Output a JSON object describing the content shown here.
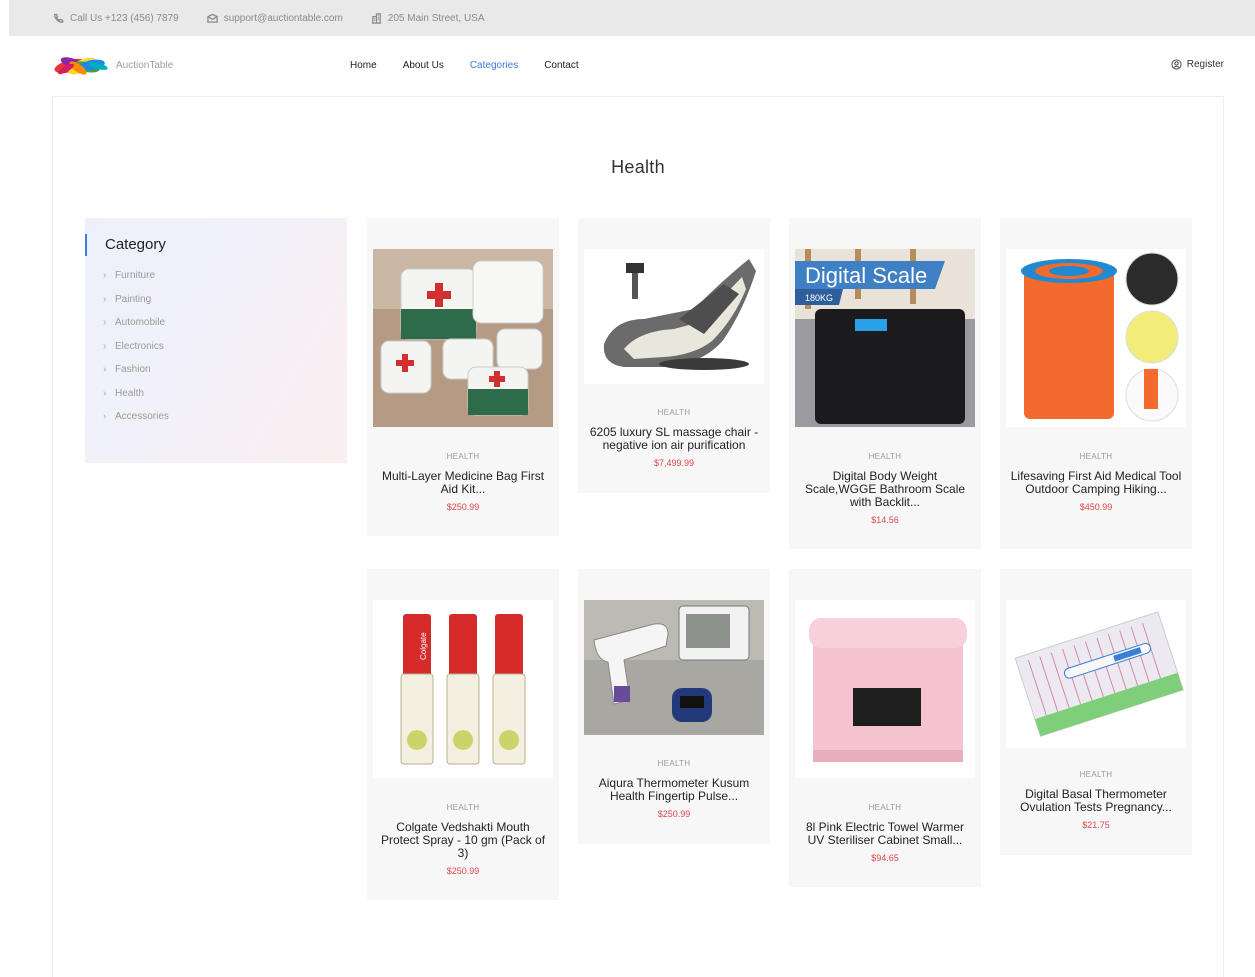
{
  "topbar": {
    "phone": "Call Us +123 (456) 7879",
    "email": "support@auctiontable.com",
    "address": "205 Main Street, USA"
  },
  "brand": {
    "name": "AuctionTable"
  },
  "nav": {
    "items": [
      {
        "label": "Home",
        "active": false
      },
      {
        "label": "About Us",
        "active": false
      },
      {
        "label": "Categories",
        "active": true
      },
      {
        "label": "Contact",
        "active": false
      }
    ],
    "register": "Register",
    "accent": "#3d7bd9"
  },
  "page": {
    "title": "Health"
  },
  "sidebar": {
    "title": "Category",
    "items": [
      "Furniture",
      "Painting",
      "Automobile",
      "Electronics",
      "Fashion",
      "Health",
      "Accessories"
    ]
  },
  "products": [
    {
      "category": "HEALTH",
      "name": "Multi-Layer Medicine Bag First Aid Kit...",
      "price": "$250.99"
    },
    {
      "category": "HEALTH",
      "name": "6205 luxury SL massage chair - negative ion air purification",
      "price": "$7,499.99"
    },
    {
      "category": "HEALTH",
      "name": "Digital Body Weight Scale,WGGE Bathroom Scale with Backlit...",
      "price": "$14.56",
      "image_text": "Digital Scale",
      "image_subtext": "180KG"
    },
    {
      "category": "HEALTH",
      "name": "Lifesaving First Aid Medical Tool Outdoor Camping Hiking...",
      "price": "$450.99"
    },
    {
      "category": "HEALTH",
      "name": "Colgate Vedshakti Mouth Protect Spray - 10 gm (Pack of 3)",
      "price": "$250.99",
      "image_text": "Colgate"
    },
    {
      "category": "HEALTH",
      "name": "Aiqura Thermometer Kusum Health Fingertip Pulse...",
      "price": "$250.99"
    },
    {
      "category": "HEALTH",
      "name": "8l Pink Electric Towel Warmer UV Steriliser Cabinet Small...",
      "price": "$94.65"
    },
    {
      "category": "HEALTH",
      "name": "Digital Basal Thermometer Ovulation Tests Pregnancy...",
      "price": "$21.75"
    }
  ],
  "colors": {
    "price": "#e0474c",
    "card_bg": "#f7f7f7",
    "topbar_bg": "#e9e9e9"
  }
}
